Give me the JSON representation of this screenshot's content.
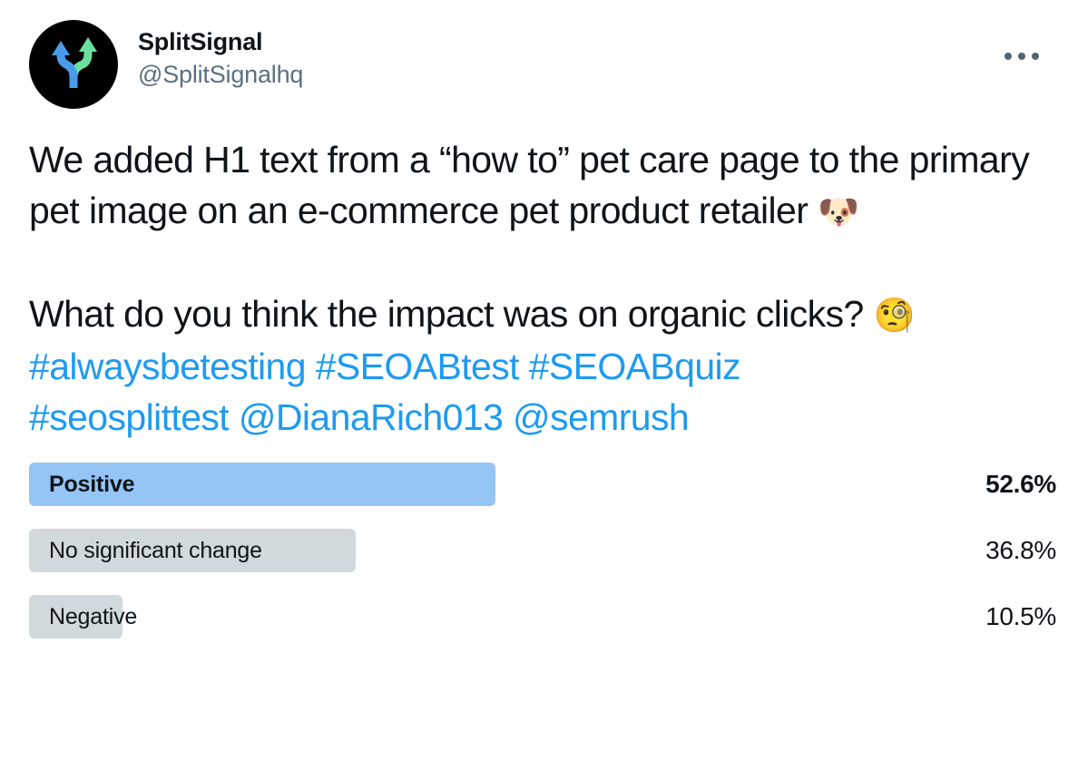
{
  "account": {
    "display_name": "SplitSignal",
    "handle": "@SplitSignalhq",
    "avatar_icon": "split-path-arrows-icon",
    "avatar_bg": "#000000",
    "avatar_arrow_blue": "#4A9BE8",
    "avatar_arrow_green": "#6BDFA0"
  },
  "header": {
    "more_icon": "more-options-ellipsis-icon"
  },
  "tweet": {
    "paragraph_1_part_1": "We added H1 text from a “how to” pet care page to the primary pet image on an e-commerce pet product retailer ",
    "paragraph_1_emoji": "🐶",
    "paragraph_2_part_1": "What do you think the impact was on organic clicks? ",
    "paragraph_2_emoji": "🧐",
    "hashtags_line_1": "#alwaysbetesting #SEOABtest #SEOABquiz",
    "hashtags_line_2": "#seosplittest  @DianaRich013 @semrush",
    "link_color": "#1D9BF0"
  },
  "poll": {
    "winner_color": "#95C5F5",
    "bar_color": "#D2D9DD",
    "options": [
      {
        "label": "Positive",
        "percent": "52.6%",
        "value": 52.6,
        "winner": true
      },
      {
        "label": "No significant change",
        "percent": "36.8%",
        "value": 36.8,
        "winner": false
      },
      {
        "label": "Negative",
        "percent": "10.5%",
        "value": 10.5,
        "winner": false
      }
    ]
  }
}
